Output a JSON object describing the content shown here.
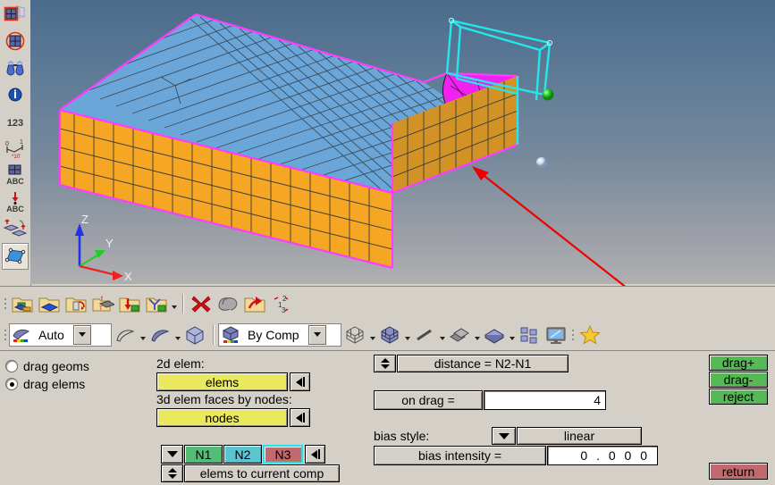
{
  "app": {
    "name": "hypermesh-drag-panel",
    "panel_title": "drag elems"
  },
  "left_toolbar": {
    "items": [
      {
        "name": "shrink-elements-icon",
        "label": "shrink elements",
        "selected": false
      },
      {
        "name": "element-normals-icon",
        "label": "element normals",
        "selected": false
      },
      {
        "name": "find-binoculars-icon",
        "label": "find",
        "selected": false
      },
      {
        "name": "info-icon",
        "label": "info",
        "selected": false
      },
      {
        "name": "numbers-123-icon",
        "label": "numbers",
        "selected": false
      },
      {
        "name": "measure-icon",
        "label": "measure",
        "selected": false
      },
      {
        "name": "element-abc-icon",
        "label": "element labels",
        "selected": false
      },
      {
        "name": "load-abc-icon",
        "label": "load labels",
        "selected": false
      },
      {
        "name": "translate-icon",
        "label": "translate",
        "selected": false
      },
      {
        "name": "drag-elems-icon",
        "label": "drag elements",
        "selected": true
      }
    ]
  },
  "toolbar_row1": {
    "items": [
      {
        "name": "geometry-collector-icon",
        "label": "collectors"
      },
      {
        "name": "component-collector-icon",
        "label": "component"
      },
      {
        "name": "assembly-collector-icon",
        "label": "assembly"
      },
      {
        "name": "title-collector-icon",
        "label": "title"
      },
      {
        "name": "import-collector-icon",
        "label": "import"
      },
      {
        "name": "organize-collector-icon",
        "label": "organize"
      },
      {
        "name": "delete-icon",
        "label": "delete"
      },
      {
        "name": "mask-icon",
        "label": "mask"
      },
      {
        "name": "reload-collector-icon",
        "label": "reload"
      },
      {
        "name": "renumber-icon",
        "label": "renumber"
      }
    ]
  },
  "toolbar_row2": {
    "mesh_mode": {
      "name": "mesh-mode-combo",
      "value": "Auto",
      "icon": "surface-color-icon"
    },
    "display_mode": {
      "name": "display-mode-combo",
      "value": "By Comp",
      "icon": "cube-color-icon"
    },
    "items": [
      {
        "name": "surface-wire-icon",
        "label": "wireframe surface"
      },
      {
        "name": "surface-shaded-icon",
        "label": "shaded surface"
      },
      {
        "name": "solid-cube-icon",
        "label": "solid"
      },
      {
        "name": "mesh-wire-cube-icon",
        "label": "mesh wireframe"
      },
      {
        "name": "mesh-shaded-cube-icon",
        "label": "mesh shaded"
      },
      {
        "name": "line-icon",
        "label": "line display"
      },
      {
        "name": "shell-icon",
        "label": "shell display"
      },
      {
        "name": "plate-icon",
        "label": "plate display"
      },
      {
        "name": "window-tile-icon",
        "label": "tile windows"
      },
      {
        "name": "monitor-icon",
        "label": "display"
      },
      {
        "name": "favorites-star-icon",
        "label": "favorites"
      }
    ]
  },
  "panel": {
    "mode_radios": [
      {
        "name": "drag-geoms-radio",
        "label": "drag geoms",
        "selected": false
      },
      {
        "name": "drag-elems-radio",
        "label": "drag elems",
        "selected": true
      }
    ],
    "selectors": [
      {
        "name": "2d-elem-selector",
        "caption": "2d elem:",
        "button_label": "elems",
        "reset_icon": "rewind-icon"
      },
      {
        "name": "3d-elem-faces-selector",
        "caption": "3d elem faces by nodes:",
        "button_label": "nodes",
        "reset_icon": "rewind-icon"
      }
    ],
    "node_row": {
      "name": "node-pick-row",
      "dropdown_icon": "chevron-down-icon",
      "nodes": [
        {
          "name": "n1-button",
          "label": "N1",
          "state": "picked"
        },
        {
          "name": "n2-button",
          "label": "N2",
          "state": "picked"
        },
        {
          "name": "n3-button",
          "label": "N3",
          "state": "active"
        }
      ],
      "reset_icon": "rewind-icon"
    },
    "dest_comp": {
      "name": "destination-component-selector",
      "stepper_icon": "up-down-arrows-icon",
      "label": "elems to current comp"
    },
    "distance": {
      "name": "distance-mode-selector",
      "stepper_icon": "up-down-arrows-icon",
      "label": "distance = N2-N1"
    },
    "on_drag": {
      "name": "on-drag-field",
      "label": "on drag =",
      "value": "4"
    },
    "bias_style": {
      "name": "bias-style-selector",
      "caption": "bias style:",
      "dropdown_icon": "chevron-down-icon",
      "value": "linear"
    },
    "bias_intensity": {
      "name": "bias-intensity-field",
      "label": "bias intensity =",
      "value": "0 . 0 0 0"
    },
    "actions": [
      {
        "name": "drag-plus-button",
        "label": "drag+",
        "color": "#55b955"
      },
      {
        "name": "drag-minus-button",
        "label": "drag-",
        "color": "#55b955"
      },
      {
        "name": "reject-button",
        "label": "reject",
        "color": "#55b955"
      }
    ],
    "return_button": {
      "name": "return-button",
      "label": "return",
      "color": "#c1696d"
    }
  },
  "viewport": {
    "name": "3d-viewport",
    "axis_triad": {
      "name": "axis-triad",
      "labels": [
        "Z",
        "Y",
        "X"
      ],
      "colors": {
        "x": "#ee2020",
        "y": "#20d020",
        "z": "#2030ee"
      }
    },
    "colors": {
      "top_shell": "#6aa6d8",
      "side_solid": "#f5a623",
      "end_solid": "#d29226",
      "highlight_surface": "#f020f0",
      "feature_edges": "#ff3cff",
      "wireframe": "#22e8ec",
      "node_green": "#22cc22",
      "node_white": "#c8d8ee",
      "annotation_arrow": "#ee0000"
    },
    "annotation": {
      "name": "red-pointer-arrow",
      "label": "pointer to dragged element faces"
    }
  }
}
